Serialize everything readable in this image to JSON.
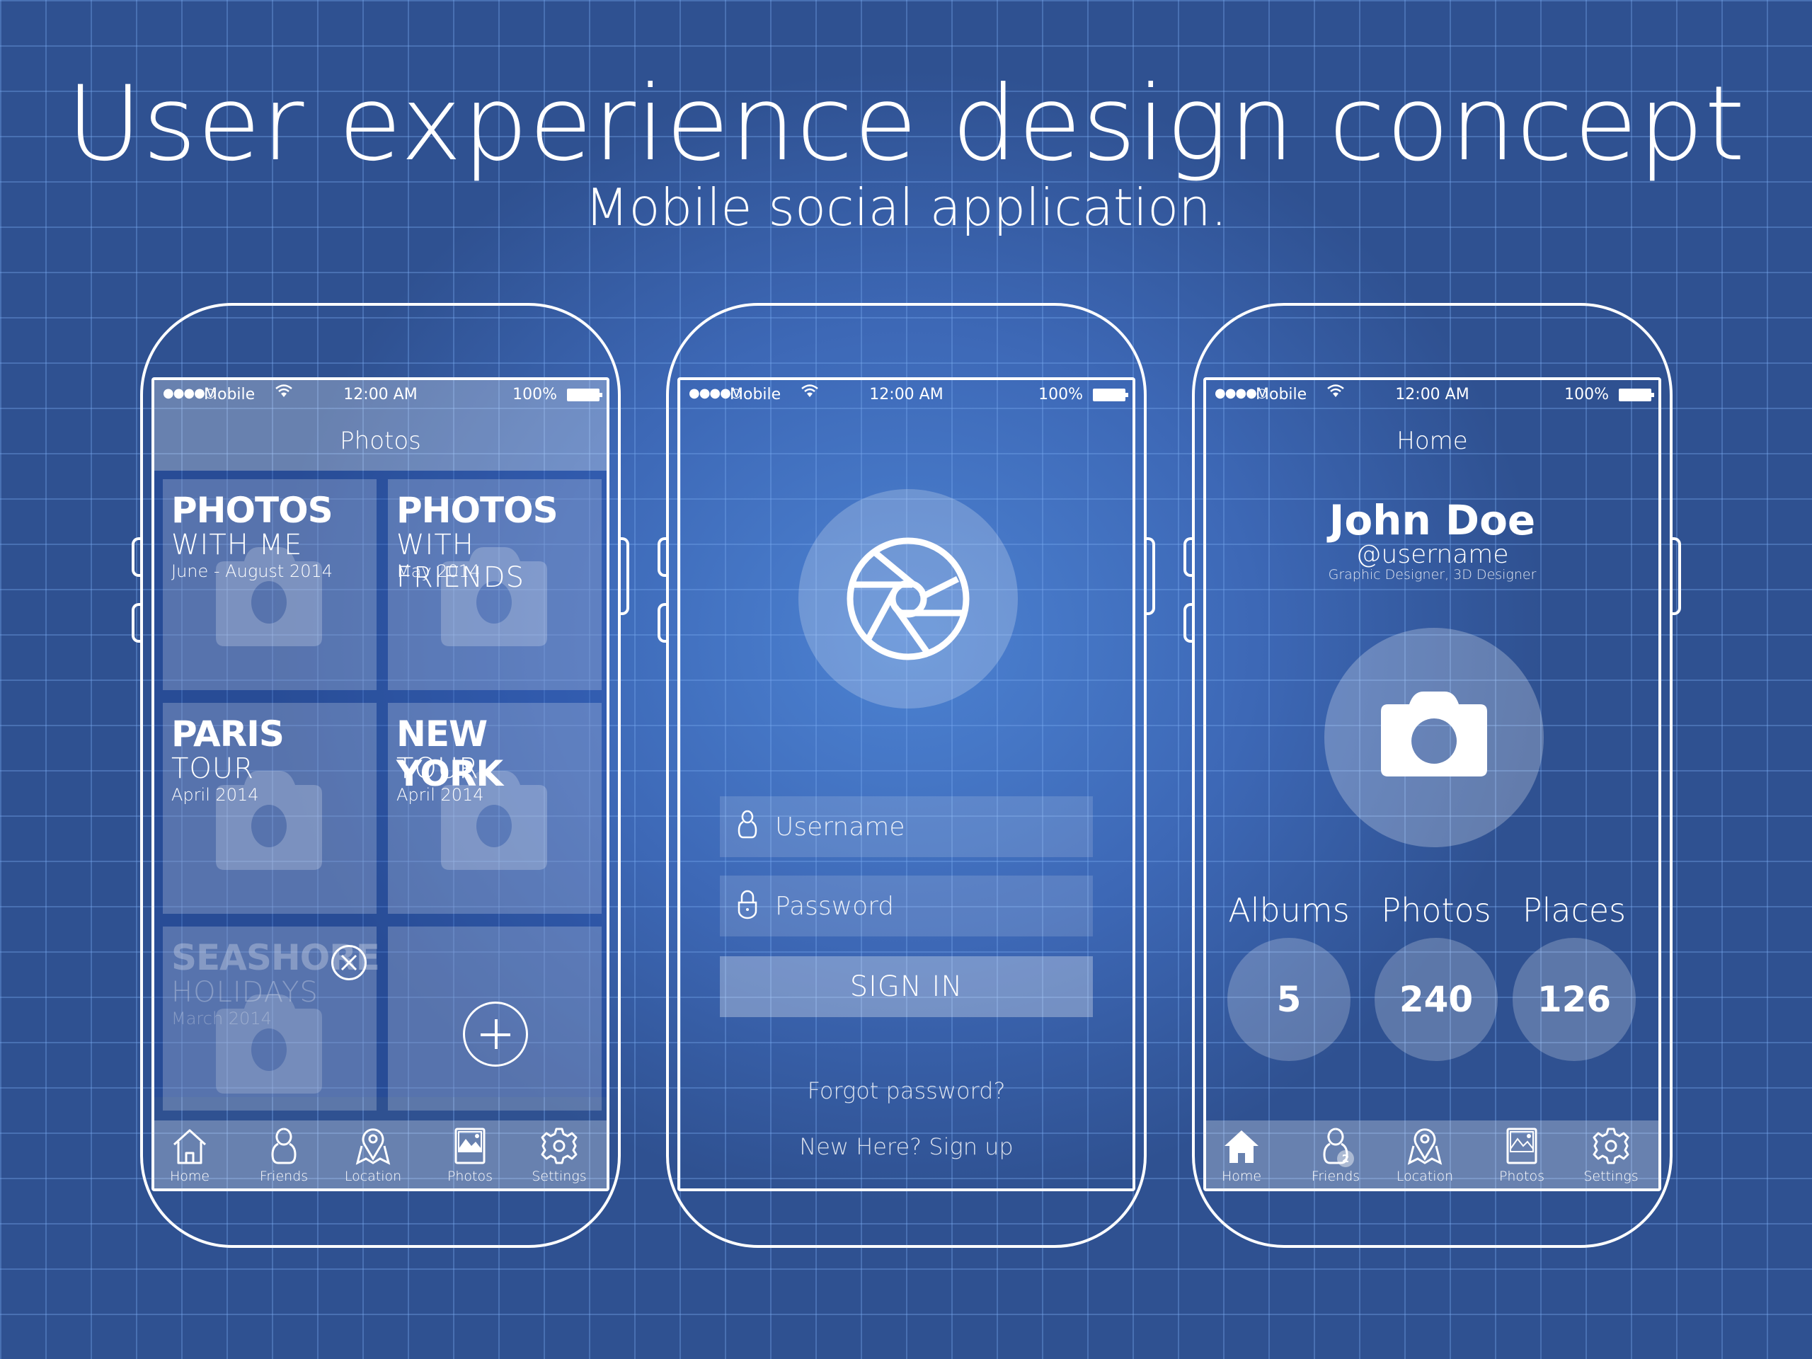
{
  "header": {
    "title": "User experience design concept",
    "subtitle": "Mobile social application."
  },
  "status_bar": {
    "signal": "●●●●○",
    "carrier": "Mobile",
    "wifi_icon": "wifi-icon",
    "time": "12:00 AM",
    "battery_percent": "100%",
    "battery_level": 1.0
  },
  "photos_screen": {
    "title": "Photos",
    "albums": [
      {
        "title": "PHOTOS",
        "subtitle": "WITH ME",
        "date": "June - August 2014",
        "state": "normal"
      },
      {
        "title": "PHOTOS",
        "subtitle": "WITH FRIENDS",
        "date": "May 2014",
        "state": "normal"
      },
      {
        "title": "PARIS",
        "subtitle": "TOUR",
        "date": "April 2014",
        "state": "normal"
      },
      {
        "title": "NEW YORK",
        "subtitle": "TOUR",
        "date": "April 2014",
        "state": "normal"
      },
      {
        "title": "SEASHORE",
        "subtitle": "HOLIDAYS",
        "date": "March 2014",
        "state": "deleting"
      }
    ],
    "close_icon": "close-circle-icon",
    "add_icon": "plus-circle-icon"
  },
  "login_screen": {
    "logo_icon": "aperture-icon",
    "username_placeholder": "Username",
    "password_placeholder": "Password",
    "signin_label": "SIGN IN",
    "forgot_label": "Forgot password?",
    "signup_label": "New Here? Sign up"
  },
  "home_screen": {
    "title": "Home",
    "name": "John Doe",
    "username": "@username",
    "role": "Graphic Designer, 3D Designer",
    "avatar_icon": "camera-icon",
    "stats": [
      {
        "label": "Albums",
        "value": "5"
      },
      {
        "label": "Photos",
        "value": "240"
      },
      {
        "label": "Places",
        "value": "126"
      }
    ]
  },
  "tabbar": {
    "items": [
      {
        "label": "Home",
        "icon": "home-icon"
      },
      {
        "label": "Friends",
        "icon": "user-icon"
      },
      {
        "label": "Location",
        "icon": "map-pin-icon"
      },
      {
        "label": "Photos",
        "icon": "image-icon"
      },
      {
        "label": "Settings",
        "icon": "gear-icon"
      }
    ],
    "friends_badge": "2"
  }
}
